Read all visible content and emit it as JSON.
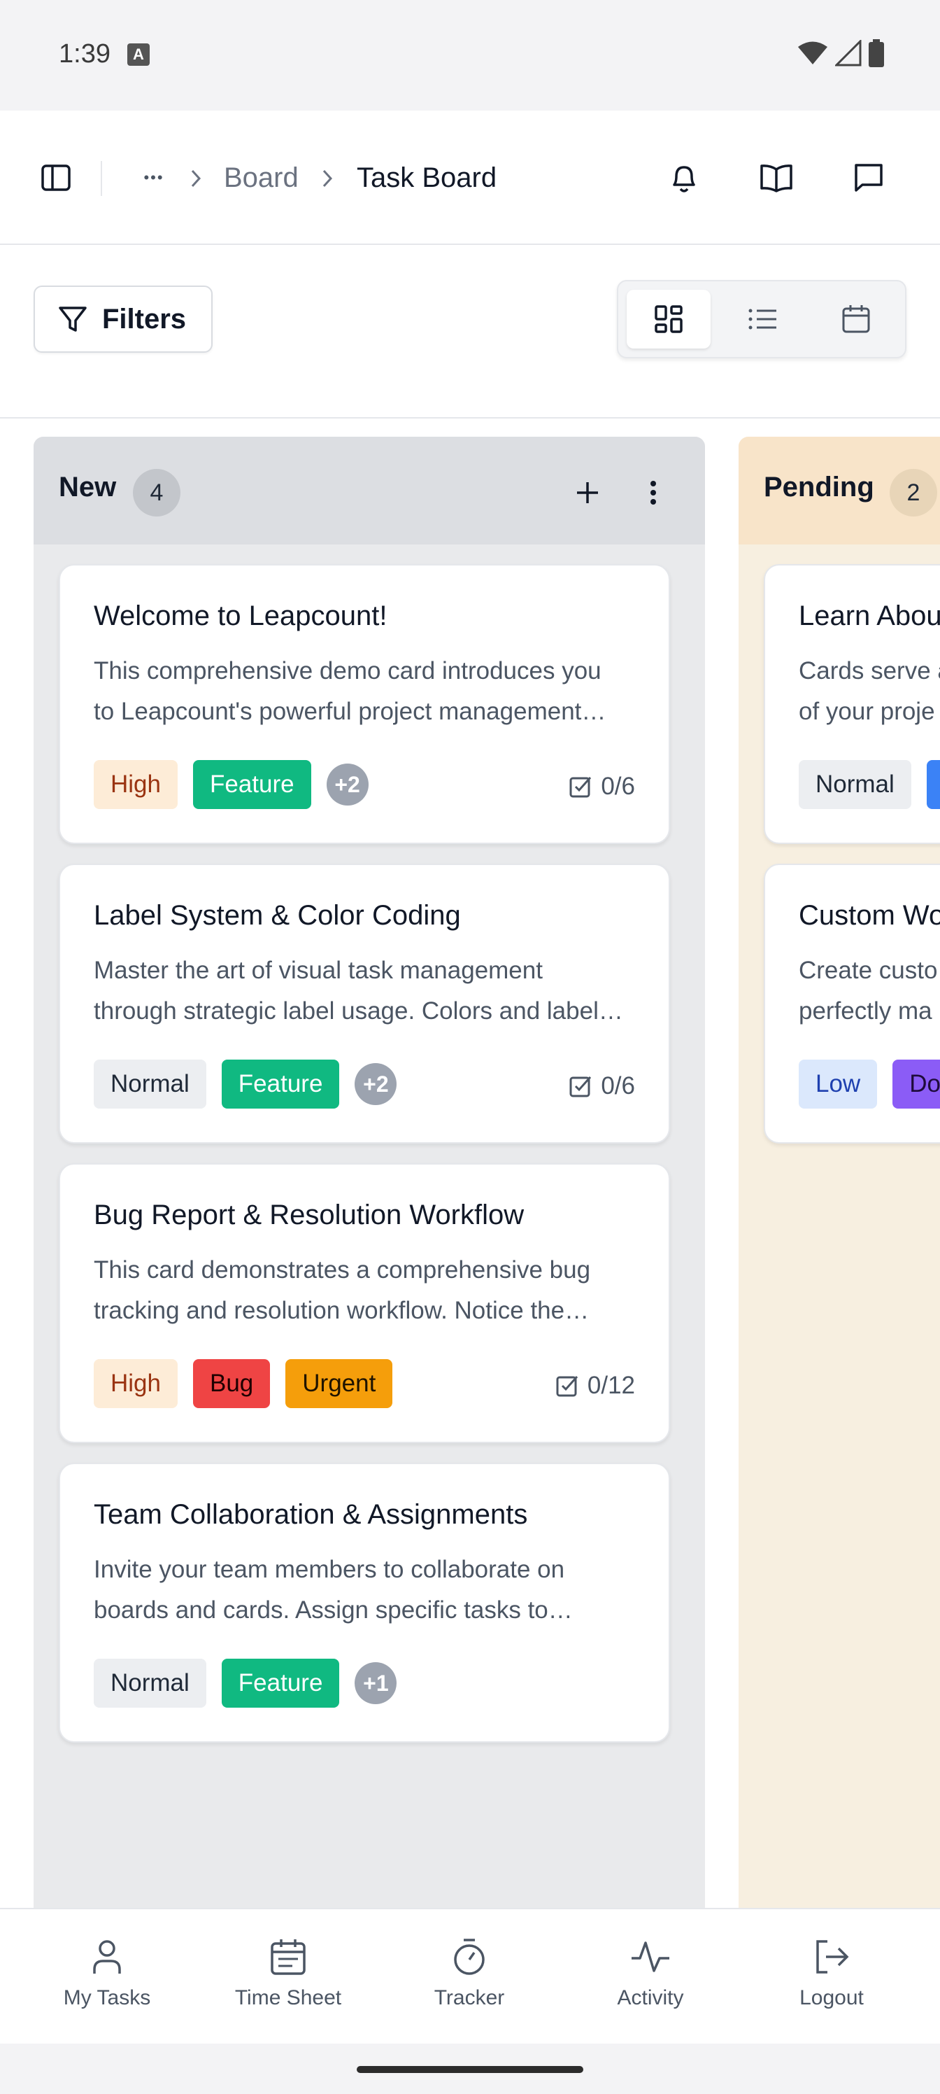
{
  "status_bar": {
    "time": "1:39",
    "notification_icon": "A"
  },
  "header": {
    "breadcrumb": {
      "ellipsis": "•••",
      "parent": "Board",
      "current": "Task Board"
    }
  },
  "toolbar": {
    "filters_label": "Filters",
    "view_modes": [
      "board-view",
      "list-view",
      "calendar-view"
    ],
    "active_view": "board-view"
  },
  "columns": [
    {
      "title": "New",
      "count": "4",
      "cards": [
        {
          "title": "Welcome to Leapcount!",
          "desc_line1": "This comprehensive demo card introduces you",
          "desc_line2": "to Leapcount's powerful project management…",
          "tags": [
            "High",
            "Feature"
          ],
          "more": "+2",
          "checklist": "0/6"
        },
        {
          "title": "Label System & Color Coding",
          "desc_line1": "Master the art of visual task management",
          "desc_line2": "through strategic label usage. Colors and label…",
          "tags": [
            "Normal",
            "Feature"
          ],
          "more": "+2",
          "checklist": "0/6"
        },
        {
          "title": "Bug Report & Resolution Workflow",
          "desc_line1": "This card demonstrates a comprehensive bug",
          "desc_line2": "tracking and resolution workflow. Notice the…",
          "tags": [
            "High",
            "Bug",
            "Urgent"
          ],
          "checklist": "0/12"
        },
        {
          "title": "Team Collaboration & Assignments",
          "desc_line1": "Invite your team members to collaborate on",
          "desc_line2": "boards and cards. Assign specific tasks to…",
          "tags": [
            "Normal",
            "Feature"
          ],
          "more": "+1"
        }
      ]
    },
    {
      "title": "Pending",
      "count": "2",
      "cards": [
        {
          "title": "Learn Abou",
          "desc_line1": "Cards serve a",
          "desc_line2": "of your proje",
          "tags": [
            "Normal"
          ]
        },
        {
          "title": "Custom Wo",
          "desc_line1": "Create custo",
          "desc_line2": "perfectly ma",
          "tags": [
            "Low",
            "Do"
          ]
        }
      ]
    }
  ],
  "bottom_nav": {
    "items": [
      {
        "label": "My Tasks",
        "icon": "user-icon"
      },
      {
        "label": "Time Sheet",
        "icon": "calendar-icon"
      },
      {
        "label": "Tracker",
        "icon": "stopwatch-icon"
      },
      {
        "label": "Activity",
        "icon": "activity-icon"
      },
      {
        "label": "Logout",
        "icon": "logout-icon"
      }
    ]
  },
  "colors": {
    "priority_high_bg": "#fdecd7",
    "feature": "#10b981",
    "bug": "#ef4444",
    "urgent": "#f59e0b",
    "new_column_bg": "#e9eaec",
    "pending_column_bg": "#f7efe0"
  }
}
